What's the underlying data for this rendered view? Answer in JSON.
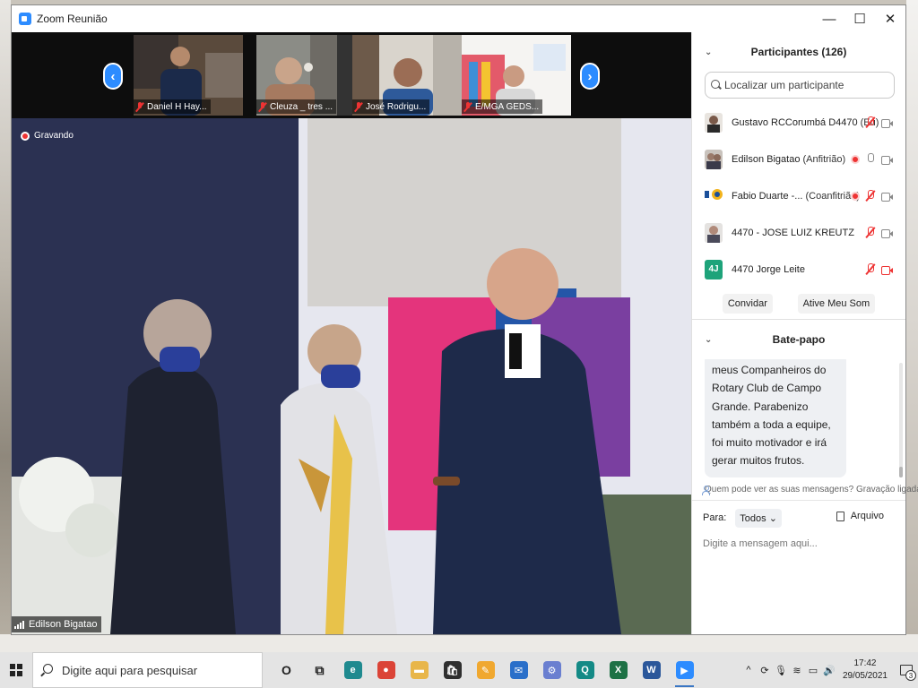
{
  "window": {
    "title": "Zoom Reunião",
    "minimize": "—",
    "maximize": "☐",
    "close": "✕"
  },
  "video": {
    "recording_label": "Gravando",
    "speaker_name": "Edilson Bigatao",
    "thumbnails": [
      {
        "name": "Daniel H Hay..."
      },
      {
        "name": "Cleuza _ tres ..."
      },
      {
        "name": "José Rodrigu..."
      },
      {
        "name": "E/MGA GEDS..."
      }
    ],
    "prev_arrow": "‹",
    "next_arrow": "›"
  },
  "participants": {
    "header": "Participantes (126)",
    "search_placeholder": "Localizar um participante",
    "list": [
      {
        "name": "Gustavo RCCorumbá D4470",
        "role": "(Eu)",
        "recording": false,
        "mic": "off",
        "cam": "on"
      },
      {
        "name": "Edilson Bigatao",
        "role": "(Anfitrião)",
        "recording": true,
        "mic": "on",
        "cam": "on"
      },
      {
        "name": "Fabio Duarte -...",
        "role": "(Coanfitrião)",
        "recording": true,
        "mic": "off",
        "cam": "on"
      },
      {
        "name": "4470 - JOSE LUIZ KREUTZ",
        "role": "",
        "recording": false,
        "mic": "off",
        "cam": "on"
      },
      {
        "name": "4470 Jorge Leite",
        "role": "",
        "recording": false,
        "mic": "off",
        "cam": "off",
        "initials": "4J"
      }
    ],
    "invite_label": "Convidar",
    "unmute_label": "Ative Meu Som"
  },
  "chat": {
    "header": "Bate-papo",
    "message": "meus Companheiros do Rotary Club de Campo Grande. Parabenizo também a toda a equipe, foi muito motivador e irá gerar muitos frutos.",
    "visibility_note": "Quem pode ver as suas mensagens? Gravação ligada",
    "to_label": "Para:",
    "to_value": "Todos",
    "file_label": "Arquivo",
    "input_placeholder": "Digite a mensagem aqui..."
  },
  "taskbar": {
    "search_placeholder": "Digite aqui para pesquisar",
    "time": "17:42",
    "date": "29/05/2021",
    "notification_count": "3",
    "apps": [
      {
        "name": "cortana",
        "label": "O",
        "color": "#e4e4e4"
      },
      {
        "name": "task-view",
        "label": "⧉",
        "color": "#e4e4e4"
      },
      {
        "name": "edge",
        "label": "e",
        "color": "#1f8a8f"
      },
      {
        "name": "chrome",
        "label": "●",
        "color": "#db4437"
      },
      {
        "name": "file-explorer",
        "label": "▬",
        "color": "#e8b64a"
      },
      {
        "name": "store",
        "label": "🛍",
        "color": "#2f2f2f"
      },
      {
        "name": "paint",
        "label": "✎",
        "color": "#f0a830"
      },
      {
        "name": "mail",
        "label": "✉",
        "color": "#2a6fc9"
      },
      {
        "name": "network-app",
        "label": "⚙",
        "color": "#6a7fd0"
      },
      {
        "name": "q-app",
        "label": "Q",
        "color": "#148a86"
      },
      {
        "name": "excel",
        "label": "X",
        "color": "#1e7145"
      },
      {
        "name": "word",
        "label": "W",
        "color": "#2b579a"
      },
      {
        "name": "zoom",
        "label": "▶",
        "color": "#2d8cff"
      }
    ]
  }
}
